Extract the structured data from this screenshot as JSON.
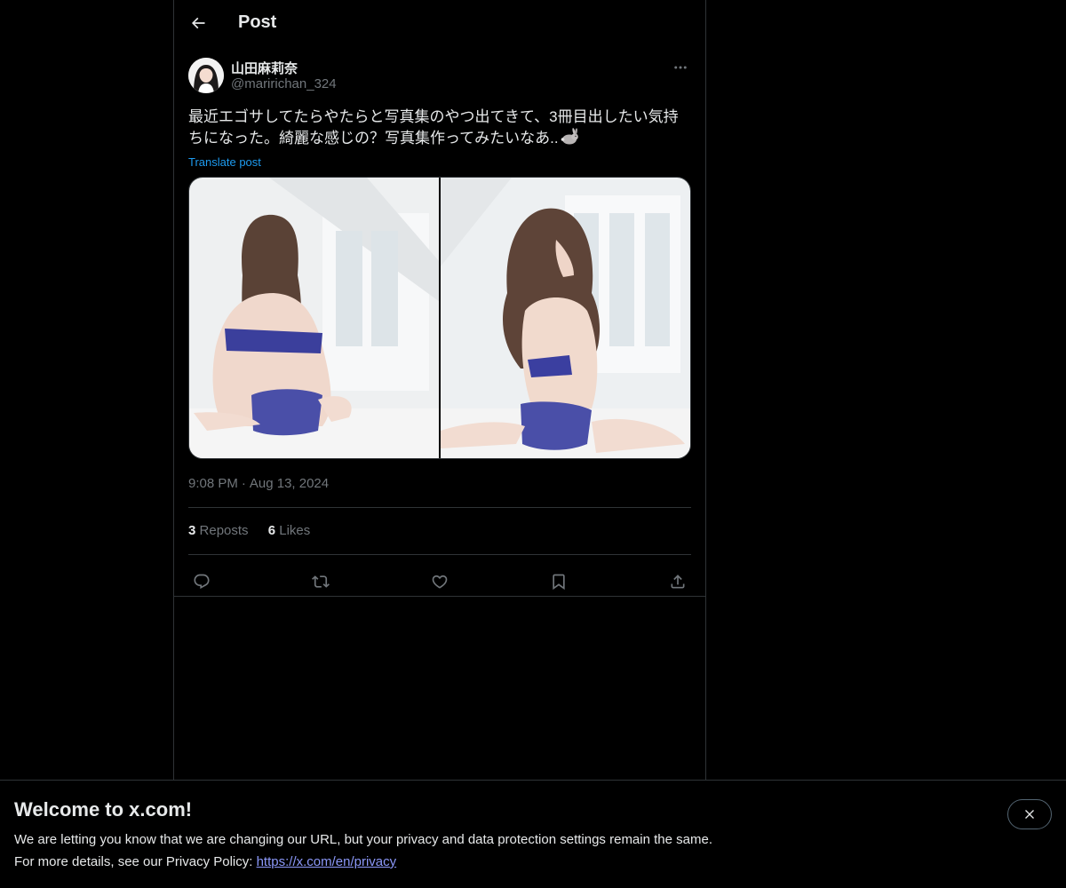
{
  "header": {
    "title": "Post",
    "back_icon": "arrow-left-icon"
  },
  "post": {
    "author": {
      "display_name": "山田麻莉奈",
      "handle": "@maririchan_324",
      "avatar_icon": "avatar"
    },
    "text": "最近エゴサしてたらやたらと写真集のやつ出てきて、3冊目出したい気持ちになった。綺麗な感じの？写真集作ってみたいなあ..",
    "text_emoji": "rabbit-emoji",
    "translate_label": "Translate post",
    "media_count": 2,
    "time": "9:08 PM",
    "separator": "·",
    "date": "Aug 13, 2024",
    "stats": {
      "reposts_count": "3",
      "reposts_label": "Reposts",
      "likes_count": "6",
      "likes_label": "Likes"
    },
    "actions": [
      "reply-icon",
      "repost-icon",
      "like-icon",
      "bookmark-icon",
      "share-icon"
    ]
  },
  "banner": {
    "title": "Welcome to x.com!",
    "line1": "We are letting you know that we are changing our URL, but your privacy and data protection settings remain the same.",
    "line2_prefix": "For more details, see our Privacy Policy: ",
    "link": "https://x.com/en/privacy",
    "close_icon": "close-icon"
  },
  "colors": {
    "background": "#000000",
    "text": "#e7e9ea",
    "muted": "#71767b",
    "accent": "#1d9bf0",
    "link": "#8b98f9",
    "border": "#2f3336"
  }
}
